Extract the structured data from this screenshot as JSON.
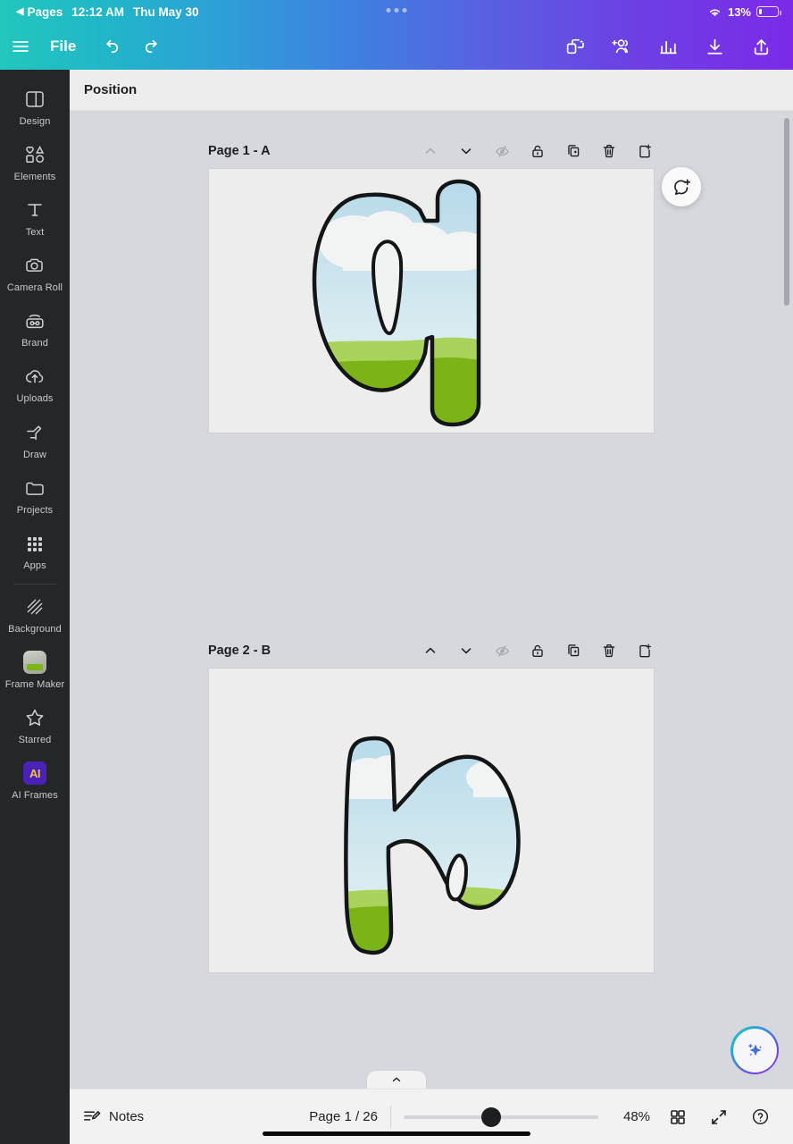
{
  "status_bar": {
    "back_label": "Pages",
    "back_caret": "◀",
    "time": "12:12 AM",
    "date": "Thu May 30",
    "wifi_icon": "wifi-icon",
    "battery_percent": "13%",
    "battery_icon": "battery-low-icon",
    "recording_dots": "loading-dots-icon"
  },
  "toolbar": {
    "menu_icon": "hamburger-menu-icon",
    "file_label": "File",
    "undo_icon": "undo-icon",
    "redo_icon": "redo-icon",
    "magic_switch_icon": "magic-switch-icon",
    "collaborators_icon": "add-collaborator-icon",
    "insights_icon": "insights-chart-icon",
    "download_icon": "download-icon",
    "share_icon": "share-icon"
  },
  "sidebar": {
    "items": [
      {
        "label": "Design",
        "icon": "design-layout-icon"
      },
      {
        "label": "Elements",
        "icon": "elements-shapes-icon"
      },
      {
        "label": "Text",
        "icon": "text-t-icon"
      },
      {
        "label": "Camera Roll",
        "icon": "camera-icon"
      },
      {
        "label": "Brand",
        "icon": "brand-radio-icon"
      },
      {
        "label": "Uploads",
        "icon": "upload-cloud-icon"
      },
      {
        "label": "Draw",
        "icon": "draw-pen-icon"
      },
      {
        "label": "Projects",
        "icon": "folder-icon"
      },
      {
        "label": "Apps",
        "icon": "apps-grid-icon"
      }
    ],
    "items_below_divider": [
      {
        "label": "Background",
        "icon": "background-hatch-icon"
      },
      {
        "label": "Frame Maker",
        "icon": "frame-maker-app-icon"
      },
      {
        "label": "Starred",
        "icon": "star-icon"
      },
      {
        "label": "AI Frames",
        "icon": "ai-frames-app-icon"
      }
    ]
  },
  "position_bar": {
    "label": "Position"
  },
  "canvas": {
    "comment_button_icon": "add-comment-icon",
    "magic_button_icon": "magic-sparkles-icon",
    "page_tools": [
      {
        "icon": "chevron-up-icon",
        "name": "move-page-up",
        "disabled": true
      },
      {
        "icon": "chevron-down-icon",
        "name": "move-page-down",
        "disabled": false
      },
      {
        "icon": "hide-page-icon",
        "name": "hide-page",
        "disabled": true
      },
      {
        "icon": "lock-icon",
        "name": "lock-page",
        "disabled": false
      },
      {
        "icon": "duplicate-page-icon",
        "name": "duplicate-page",
        "disabled": false
      },
      {
        "icon": "trash-icon",
        "name": "delete-page",
        "disabled": false
      },
      {
        "icon": "add-page-icon",
        "name": "add-page",
        "disabled": false
      }
    ],
    "pages": [
      {
        "title": "Page 1 - A",
        "letter": "a",
        "artwork": "letter-a-landscape-illustration"
      },
      {
        "title": "Page 2 - B",
        "letter": "b",
        "artwork": "letter-b-landscape-illustration"
      }
    ]
  },
  "bottom_bar": {
    "collapse_icon": "chevron-up-icon",
    "notes_label": "Notes",
    "notes_icon": "notes-icon",
    "page_counter": "Page 1 / 26",
    "zoom_level": "48%",
    "grid_view_icon": "grid-view-icon",
    "fullscreen_icon": "expand-icon",
    "help_icon": "help-circle-icon"
  },
  "colors": {
    "header_gradient_start": "#21c7bd",
    "header_gradient_end": "#7c2ae8",
    "rail_background": "#252627",
    "canvas_background": "#d6d8de",
    "page_background": "#ededed",
    "sky_top": "#b5d9ea",
    "sky_bottom": "#e3f0f3",
    "hill_light": "#a8d25c",
    "hill_dark": "#7cb518",
    "outline": "#141516"
  }
}
